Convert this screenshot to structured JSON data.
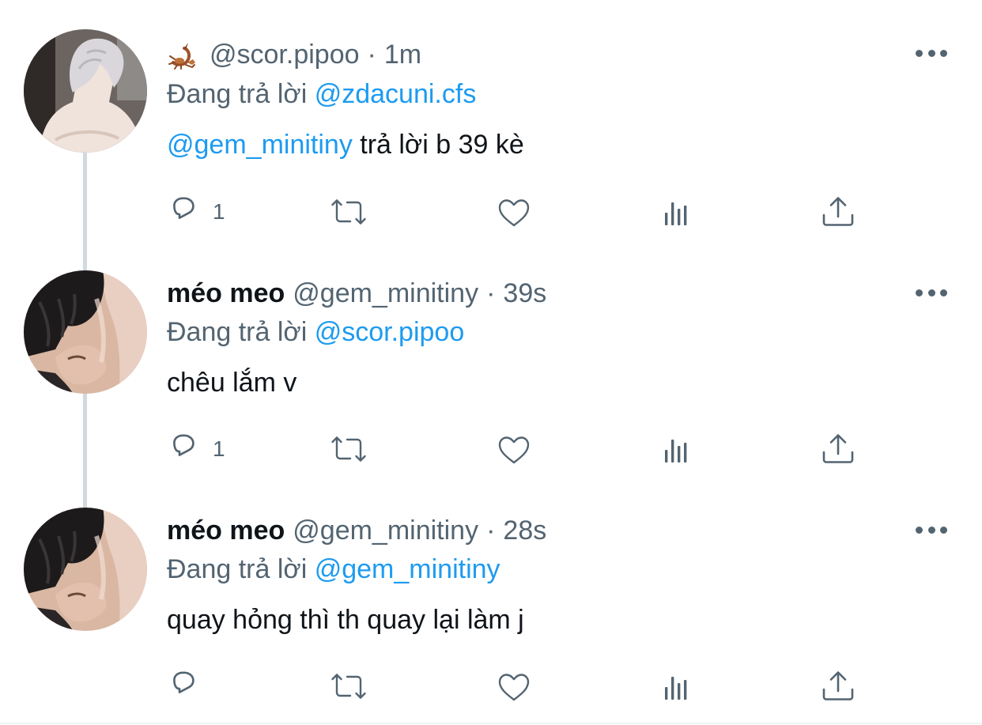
{
  "colors": {
    "link": "#1d9bf0",
    "secondary_text": "#536471",
    "primary_text": "#0f1419",
    "thread_line": "#cfd9de"
  },
  "tweets": [
    {
      "avatar": "white-haired-back-avatar",
      "emoji_icon": "scorpion-icon",
      "display_name": "",
      "handle": "@scor.pipoo",
      "separator": "·",
      "time": "1m",
      "reply_prefix": "Đang trả lời",
      "reply_to": "@zdacuni.cfs",
      "mention": "@gem_minitiny",
      "text": " trả lời b 39 kè",
      "reply_count": "1"
    },
    {
      "avatar": "dark-haired-selfie-avatar",
      "display_name": "méo meo",
      "handle": "@gem_minitiny",
      "separator": "·",
      "time": "39s",
      "reply_prefix": "Đang trả lời",
      "reply_to": "@scor.pipoo",
      "mention": "",
      "text": "chêu lắm v",
      "reply_count": "1"
    },
    {
      "avatar": "dark-haired-selfie-avatar",
      "display_name": "méo meo",
      "handle": "@gem_minitiny",
      "separator": "·",
      "time": "28s",
      "reply_prefix": "Đang trả lời",
      "reply_to": "@gem_minitiny",
      "mention": "",
      "text": "quay hỏng thì th quay lại làm j",
      "reply_count": ""
    }
  ]
}
